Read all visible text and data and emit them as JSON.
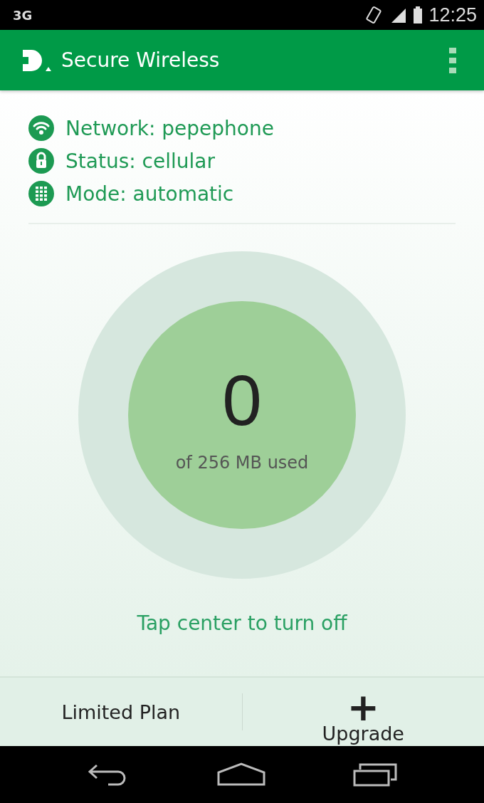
{
  "status_bar": {
    "network": "3G",
    "time": "12:25"
  },
  "app_bar": {
    "title": "Secure Wireless"
  },
  "info": [
    {
      "kind": "wifi",
      "text": "Network: pepephone"
    },
    {
      "kind": "lock",
      "text": "Status: cellular"
    },
    {
      "kind": "grid",
      "text": "Mode: automatic"
    }
  ],
  "usage": {
    "value": "0",
    "caption": "of 256 MB used"
  },
  "hint": "Tap center to turn off",
  "bottom_bar": {
    "plan": "Limited Plan",
    "upgrade_icon": "+",
    "upgrade": "Upgrade"
  }
}
